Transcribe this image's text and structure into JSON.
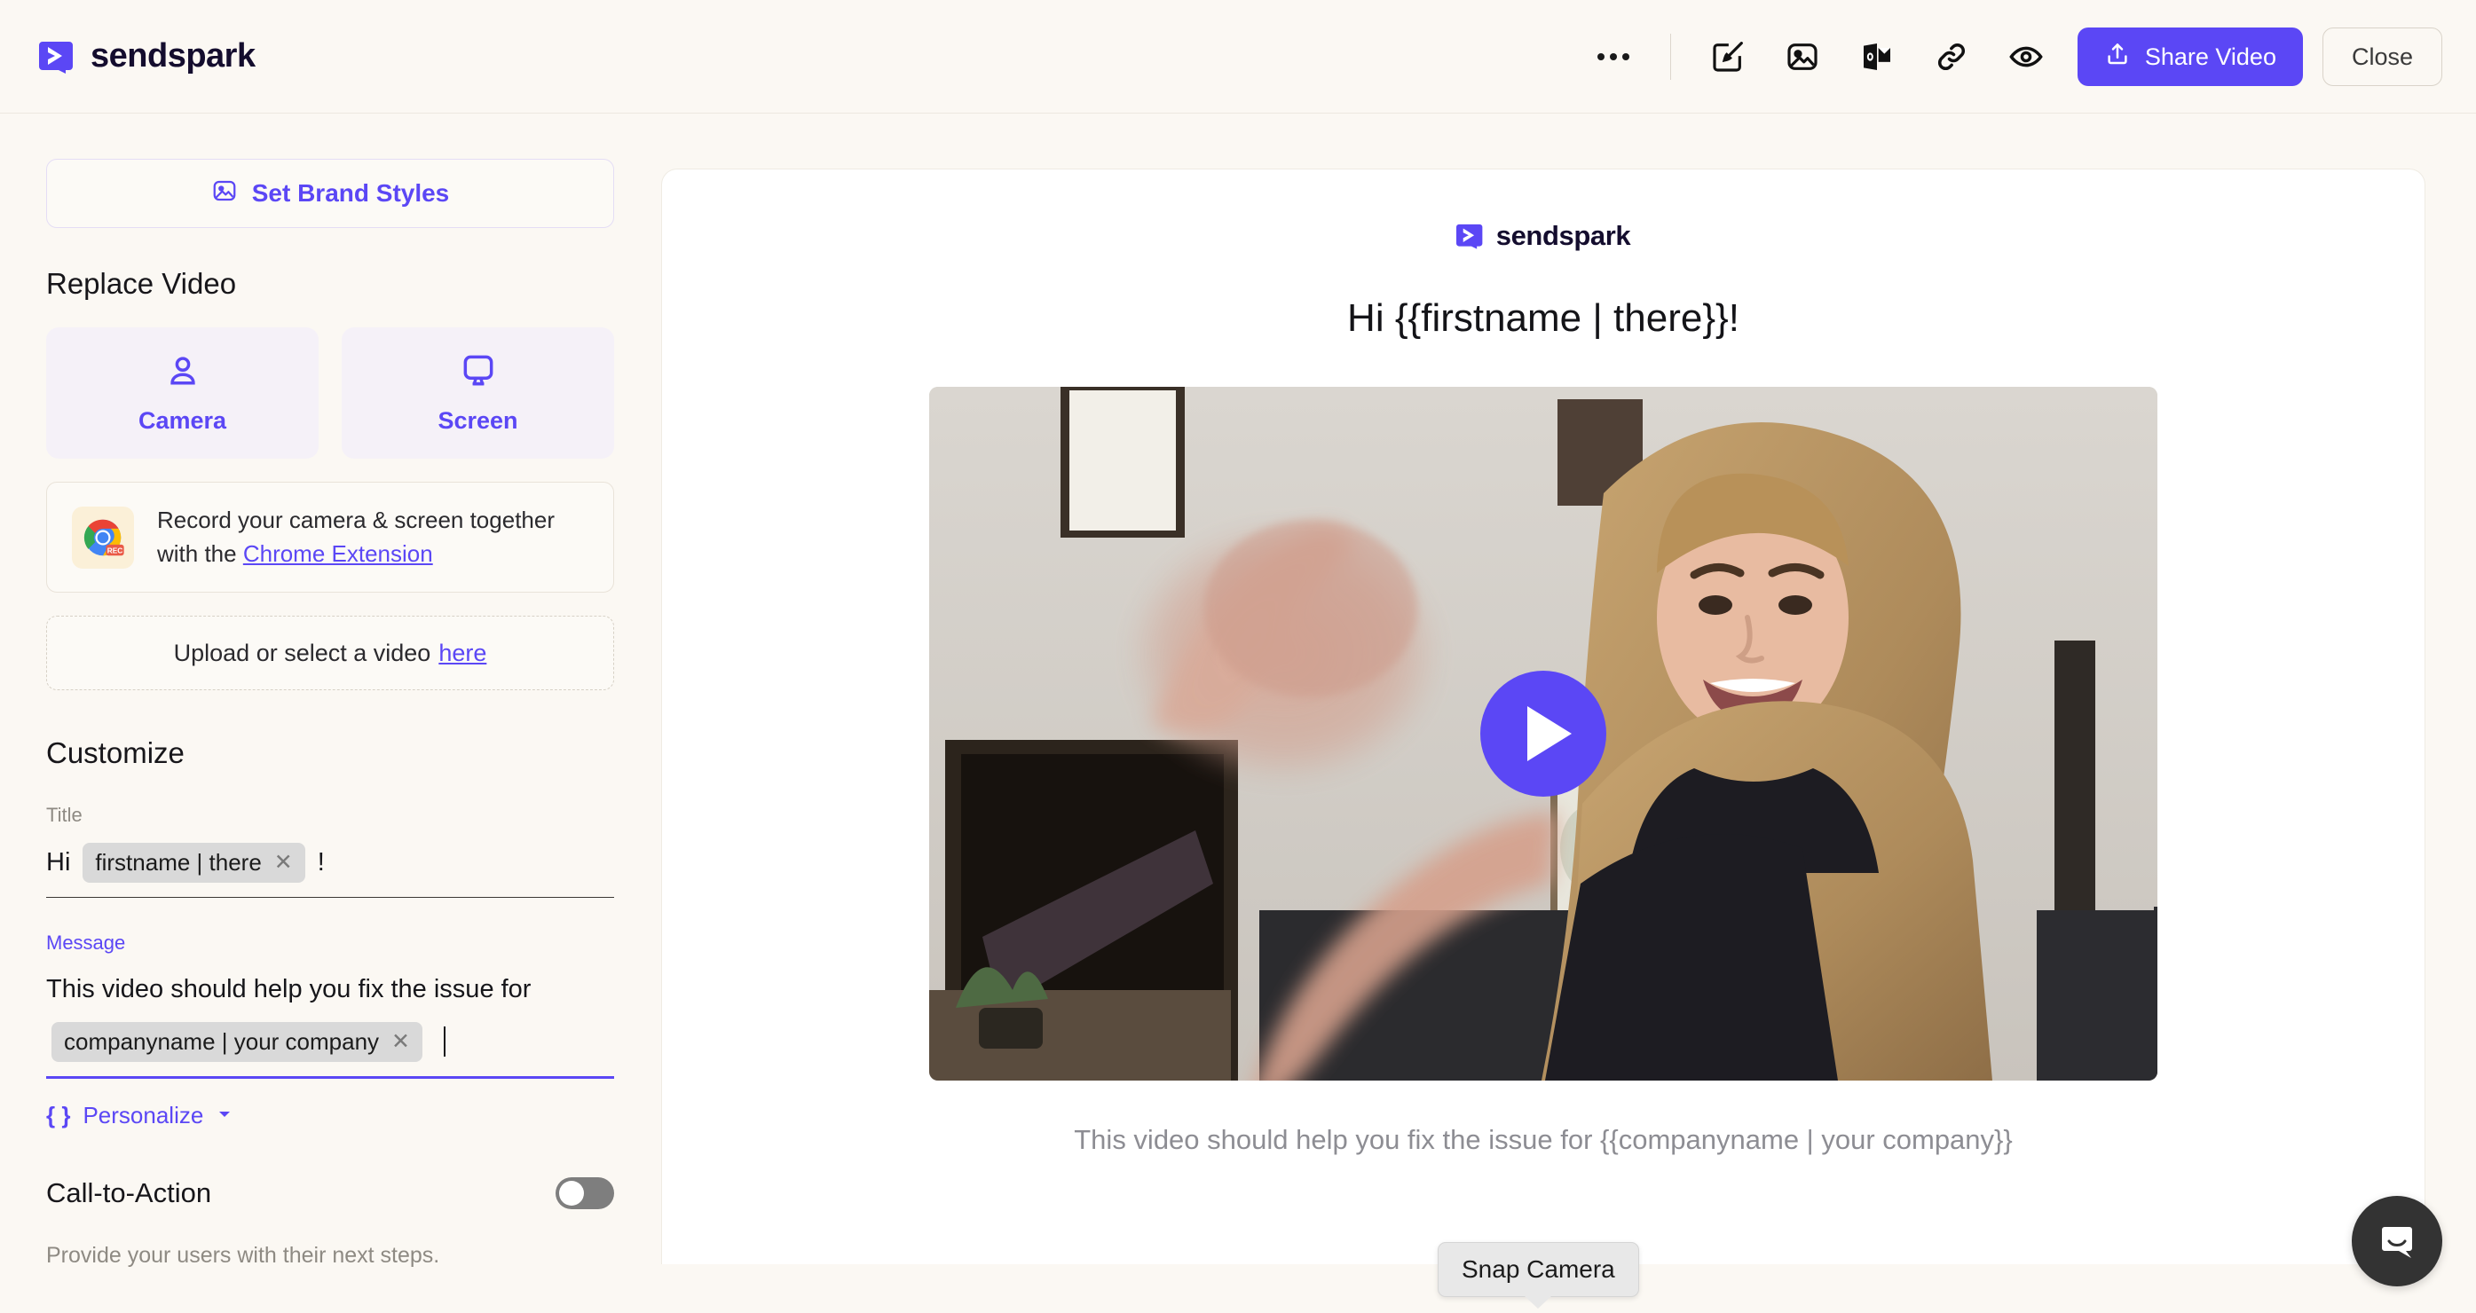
{
  "brand": {
    "name": "sendspark",
    "accent": "#5B47F5",
    "logo_icon": "sendspark-logo-icon"
  },
  "topbar": {
    "more_icon": "more-options-icon",
    "actions": [
      {
        "icon": "edit-brush-icon",
        "name": "customize-icon"
      },
      {
        "icon": "image-icon",
        "name": "thumbnail-icon"
      },
      {
        "icon": "outlook-icon",
        "name": "outlook-icon"
      },
      {
        "icon": "link-icon",
        "name": "copy-link-icon"
      },
      {
        "icon": "eye-icon",
        "name": "preview-icon"
      }
    ],
    "share_label": "Share Video",
    "share_icon": "upload-icon",
    "close_label": "Close"
  },
  "sidebar": {
    "brand_styles_label": "Set Brand Styles",
    "brand_styles_icon": "image-icon",
    "replace_video_title": "Replace Video",
    "tiles": [
      {
        "label": "Camera",
        "icon": "person-icon"
      },
      {
        "label": "Screen",
        "icon": "monitor-icon"
      }
    ],
    "extension": {
      "icon": "chrome-rec-icon",
      "badge": "REC",
      "text_before": "Record your camera & screen together with the ",
      "link": "Chrome Extension"
    },
    "upload": {
      "text": "Upload or select a video",
      "link": "here"
    },
    "customize_title": "Customize",
    "title_field": {
      "label": "Title",
      "prefix": "Hi",
      "chip": "firstname | there",
      "chip_remove_icon": "close-icon",
      "suffix": "!"
    },
    "message_field": {
      "label": "Message",
      "text": "This video should help you fix the issue for",
      "chip": "companyname | your company",
      "chip_remove_icon": "close-icon"
    },
    "personalize_label": "Personalize",
    "personalize_icon": "curly-braces-icon",
    "personalize_caret": "chevron-down-icon",
    "cta": {
      "label": "Call-to-Action",
      "toggle_state": "off",
      "description": "Provide your users with their next steps."
    }
  },
  "preview": {
    "logo_text": "sendspark",
    "title": "Hi {{firstname | there}}!",
    "play_icon": "play-icon",
    "caption": "This video should help you fix the issue for {{companyname | your company}}"
  },
  "tooltip": {
    "text": "Snap Camera"
  },
  "intercom": {
    "icon": "intercom-chat-icon"
  }
}
